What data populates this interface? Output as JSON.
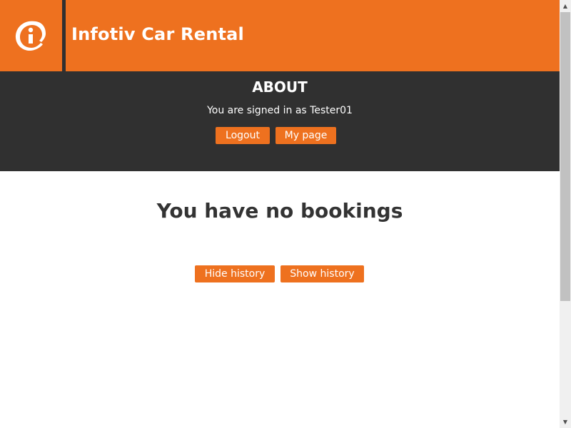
{
  "header": {
    "title": "Infotiv Car Rental",
    "logo_icon": "infotiv-logo-icon"
  },
  "about": {
    "title": "ABOUT",
    "signed_in_text": "You are signed in as Tester01",
    "logout_label": "Logout",
    "mypage_label": "My page"
  },
  "main": {
    "no_bookings_text": "You have no bookings",
    "hide_history_label": "Hide history",
    "show_history_label": "Show history"
  },
  "scrollbar": {
    "up_icon": "▲",
    "down_icon": "▼"
  },
  "colors": {
    "brand_orange": "#ee711f",
    "dark_band": "#303030",
    "heading_text": "#333333"
  }
}
